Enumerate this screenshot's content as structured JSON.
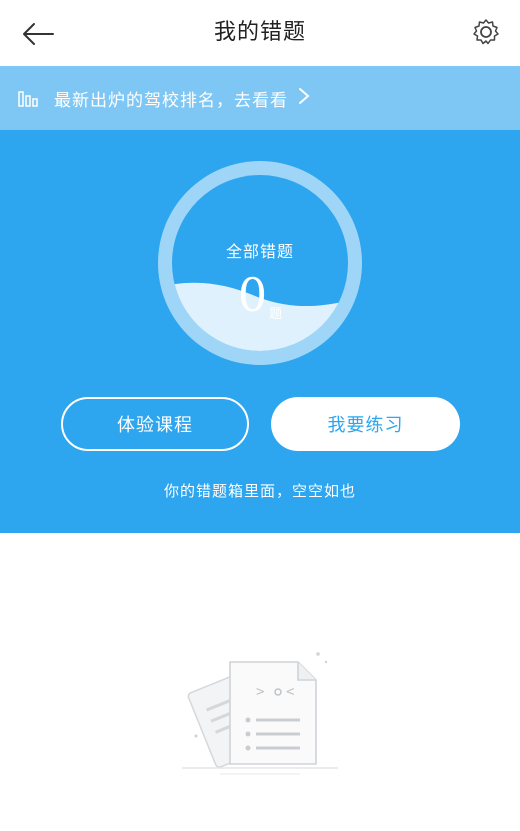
{
  "header": {
    "title": "我的错题"
  },
  "banner": {
    "text": "最新出炉的驾校排名，去看看"
  },
  "summary": {
    "label": "全部错题",
    "count": "0",
    "unit": "题"
  },
  "actions": {
    "course_label": "体验课程",
    "practice_label": "我要练习"
  },
  "note": "你的错题箱里面，空空如也",
  "colors": {
    "primary": "#2da5ef",
    "banner": "#7ec7f5",
    "white": "#ffffff"
  },
  "icons": [
    "back-arrow-icon",
    "gear-icon",
    "bar-chart-icon",
    "chevron-right-icon",
    "empty-documents-icon"
  ]
}
